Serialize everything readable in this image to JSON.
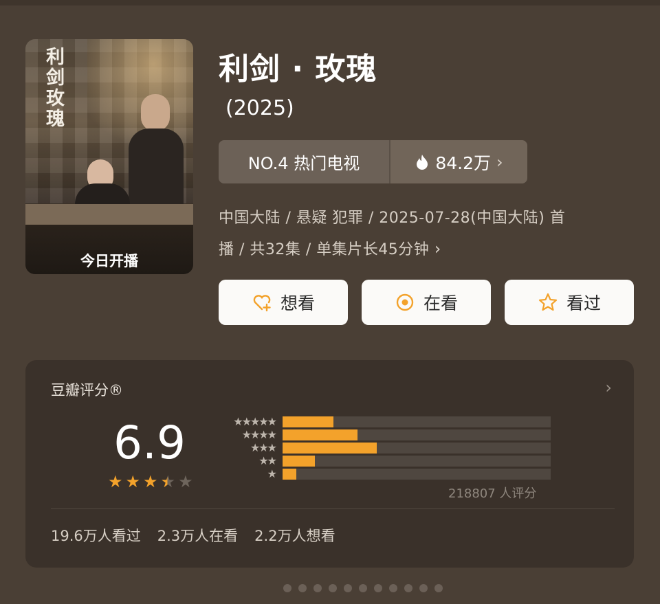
{
  "poster": {
    "vertical_title": "利剑玫瑰",
    "badge": "今日开播"
  },
  "header": {
    "title": "利剑 · 玫瑰",
    "year": "(2025)"
  },
  "rank": {
    "label": "NO.4 热门电视",
    "heat": "84.2万",
    "heat_icon": "flame-icon"
  },
  "meta": {
    "line1": "中国大陆 / 悬疑 犯罪 / 2025-07-28(中国大陆) 首",
    "line2": "播 / 共32集 / 单集片长45分钟"
  },
  "actions": {
    "want": "想看",
    "watching": "在看",
    "watched": "看过",
    "icon_color": "#f3a22b"
  },
  "rating": {
    "title": "豆瓣评分®",
    "score": "6.9",
    "stars_fraction": 0.69,
    "distribution": [
      {
        "stars": 5,
        "label": "★★★★★",
        "fraction": 0.19
      },
      {
        "stars": 4,
        "label": "★★★★",
        "fraction": 0.28
      },
      {
        "stars": 3,
        "label": "★★★",
        "fraction": 0.35
      },
      {
        "stars": 2,
        "label": "★★",
        "fraction": 0.12
      },
      {
        "stars": 1,
        "label": "★",
        "fraction": 0.05
      }
    ],
    "count": "218807 人评分",
    "stats": [
      "19.6万人看过",
      "2.3万人在看",
      "2.2万人想看"
    ]
  }
}
